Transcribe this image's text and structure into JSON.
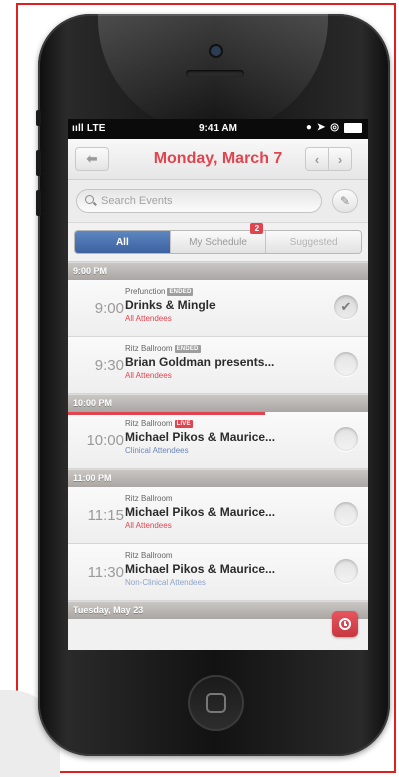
{
  "statusbar": {
    "carrier": "ııll LTE",
    "time": "9:41 AM"
  },
  "navbar": {
    "title": "Monday, March 7"
  },
  "search": {
    "placeholder": "Search Events"
  },
  "tabs": [
    {
      "label": "All",
      "active": true
    },
    {
      "label": "My Schedule",
      "badge": "2"
    },
    {
      "label": "Suggested"
    }
  ],
  "schedule": [
    {
      "section": "9:00 PM",
      "events": [
        {
          "time": "9:00",
          "venue": "Prefunction",
          "tag": "ENDED",
          "title": "Drinks & Mingle",
          "audience": "All Attendees",
          "audience_color": "#e0454f",
          "checked": true
        },
        {
          "time": "9:30",
          "venue": "Ritz Ballroom",
          "tag": "ENDED",
          "title": "Brian Goldman presents...",
          "audience": "All Attendees",
          "audience_color": "#e0454f",
          "checked": false
        }
      ]
    },
    {
      "section": "10:00 PM",
      "events": [
        {
          "time": "10:00",
          "venue": "Ritz Ballroom",
          "tag": "LIVE",
          "title": "Michael Pikos & Maurice...",
          "audience": "Clinical Attendees",
          "audience_color": "#6d86b8",
          "checked": false
        }
      ]
    },
    {
      "section": "11:00 PM",
      "events": [
        {
          "time": "11:15",
          "venue": "Ritz Ballroom",
          "tag": "",
          "title": "Michael Pikos & Maurice...",
          "audience": "All Attendees",
          "audience_color": "#e0454f",
          "checked": false
        },
        {
          "time": "11:30",
          "venue": "Ritz Ballroom",
          "tag": "",
          "title": "Michael Pikos & Maurice...",
          "audience": "Non-Clinical Attendees",
          "audience_color": "#8fa3c8",
          "checked": false
        }
      ]
    },
    {
      "section": "Tuesday, May 23",
      "events": []
    }
  ],
  "colors": {
    "accent": "#e0454f",
    "tab_active": "#4a70ad"
  }
}
